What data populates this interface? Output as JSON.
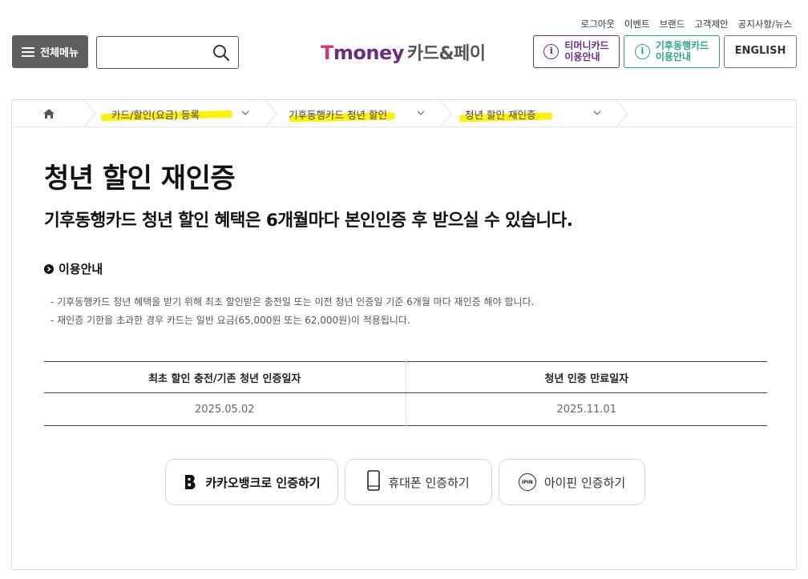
{
  "util_links": [
    "로그아웃",
    "이벤트",
    "브랜드",
    "고객제안",
    "공지사항/뉴스"
  ],
  "header": {
    "menu_label": "전체메뉴",
    "search_placeholder": "",
    "logo_brand_t": "T",
    "logo_brand_rest": "money",
    "logo_sub": "카드&페이",
    "tmoney_btn": [
      "티머니카드",
      "이용안내"
    ],
    "climate_btn": [
      "기후동행카드",
      "이용안내"
    ],
    "english_btn": "ENGLISH",
    "colors": {
      "tmoney": "#6d2b83",
      "climate": "#2aa38b"
    }
  },
  "breadcrumb": {
    "home_icon": "home-icon",
    "items": [
      "카드/할인(요금) 등록",
      "기후동행카드 청년 할인",
      "청년 할인 재인증"
    ]
  },
  "main": {
    "title": "청년 할인 재인증",
    "subtitle": "기후동행카드 청년 할인 혜택은 6개월마다 본인인증 후 받으실 수 있습니다.",
    "info_heading": "이용안내",
    "info_items": [
      "- 기후동행카드 청년 혜택을 받기 위해 최초 할인받은 충전일 또는 이전 청년 인증일 기준 6개월 마다 재인증 해야 합니다.",
      "- 재인증 기한을 초과한 경우 카드는 일반 요금(65,000원 또는 62,000원)이 적용됩니다."
    ],
    "table": {
      "headers": [
        "최초 할인 충전/기존 청년 인증일자",
        "청년 인증 만료일자"
      ],
      "row": [
        "2025.05.02",
        "2025.11.01"
      ]
    },
    "auth_buttons": [
      "카카오뱅크로 인증하기",
      "휴대폰 인증하기",
      "아이핀 인증하기"
    ],
    "ipin_icon_text": "IPIN"
  }
}
